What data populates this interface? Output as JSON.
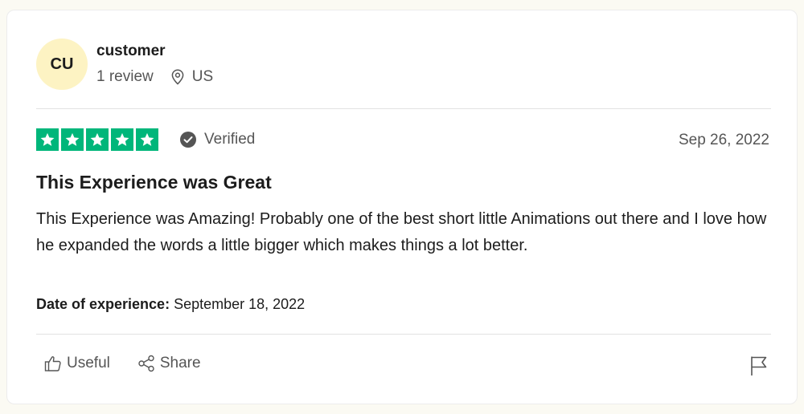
{
  "reviewer": {
    "initials": "CU",
    "name": "customer",
    "review_count": "1 review",
    "location": "US",
    "avatar_bg": "#fdf3c3"
  },
  "rating": {
    "stars": 5,
    "max_stars": 5,
    "star_color": "#00b67a",
    "verified_label": "Verified",
    "date": "Sep 26, 2022"
  },
  "review": {
    "title": "This Experience was Great",
    "body": "This Experience was Amazing! Probably one of the best short little Animations out there and I love how he expanded the words a little bigger which makes things a lot better.",
    "experience_label": "Date of experience:",
    "experience_date": "September 18, 2022"
  },
  "actions": {
    "useful_label": "Useful",
    "share_label": "Share",
    "useful_icon": "thumbs-up-icon",
    "share_icon": "share-icon",
    "flag_icon": "flag-icon"
  }
}
